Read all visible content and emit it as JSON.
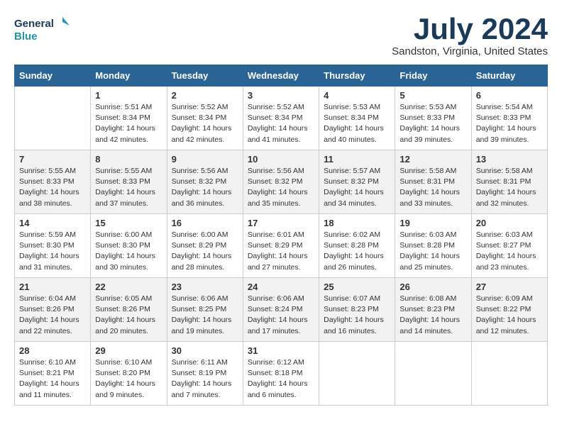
{
  "logo": {
    "line1": "General",
    "line2": "Blue"
  },
  "title": "July 2024",
  "location": "Sandston, Virginia, United States",
  "days_header": [
    "Sunday",
    "Monday",
    "Tuesday",
    "Wednesday",
    "Thursday",
    "Friday",
    "Saturday"
  ],
  "weeks": [
    [
      {
        "day": "",
        "info": ""
      },
      {
        "day": "1",
        "info": "Sunrise: 5:51 AM\nSunset: 8:34 PM\nDaylight: 14 hours\nand 42 minutes."
      },
      {
        "day": "2",
        "info": "Sunrise: 5:52 AM\nSunset: 8:34 PM\nDaylight: 14 hours\nand 42 minutes."
      },
      {
        "day": "3",
        "info": "Sunrise: 5:52 AM\nSunset: 8:34 PM\nDaylight: 14 hours\nand 41 minutes."
      },
      {
        "day": "4",
        "info": "Sunrise: 5:53 AM\nSunset: 8:34 PM\nDaylight: 14 hours\nand 40 minutes."
      },
      {
        "day": "5",
        "info": "Sunrise: 5:53 AM\nSunset: 8:33 PM\nDaylight: 14 hours\nand 39 minutes."
      },
      {
        "day": "6",
        "info": "Sunrise: 5:54 AM\nSunset: 8:33 PM\nDaylight: 14 hours\nand 39 minutes."
      }
    ],
    [
      {
        "day": "7",
        "info": "Sunrise: 5:55 AM\nSunset: 8:33 PM\nDaylight: 14 hours\nand 38 minutes."
      },
      {
        "day": "8",
        "info": "Sunrise: 5:55 AM\nSunset: 8:33 PM\nDaylight: 14 hours\nand 37 minutes."
      },
      {
        "day": "9",
        "info": "Sunrise: 5:56 AM\nSunset: 8:32 PM\nDaylight: 14 hours\nand 36 minutes."
      },
      {
        "day": "10",
        "info": "Sunrise: 5:56 AM\nSunset: 8:32 PM\nDaylight: 14 hours\nand 35 minutes."
      },
      {
        "day": "11",
        "info": "Sunrise: 5:57 AM\nSunset: 8:32 PM\nDaylight: 14 hours\nand 34 minutes."
      },
      {
        "day": "12",
        "info": "Sunrise: 5:58 AM\nSunset: 8:31 PM\nDaylight: 14 hours\nand 33 minutes."
      },
      {
        "day": "13",
        "info": "Sunrise: 5:58 AM\nSunset: 8:31 PM\nDaylight: 14 hours\nand 32 minutes."
      }
    ],
    [
      {
        "day": "14",
        "info": "Sunrise: 5:59 AM\nSunset: 8:30 PM\nDaylight: 14 hours\nand 31 minutes."
      },
      {
        "day": "15",
        "info": "Sunrise: 6:00 AM\nSunset: 8:30 PM\nDaylight: 14 hours\nand 30 minutes."
      },
      {
        "day": "16",
        "info": "Sunrise: 6:00 AM\nSunset: 8:29 PM\nDaylight: 14 hours\nand 28 minutes."
      },
      {
        "day": "17",
        "info": "Sunrise: 6:01 AM\nSunset: 8:29 PM\nDaylight: 14 hours\nand 27 minutes."
      },
      {
        "day": "18",
        "info": "Sunrise: 6:02 AM\nSunset: 8:28 PM\nDaylight: 14 hours\nand 26 minutes."
      },
      {
        "day": "19",
        "info": "Sunrise: 6:03 AM\nSunset: 8:28 PM\nDaylight: 14 hours\nand 25 minutes."
      },
      {
        "day": "20",
        "info": "Sunrise: 6:03 AM\nSunset: 8:27 PM\nDaylight: 14 hours\nand 23 minutes."
      }
    ],
    [
      {
        "day": "21",
        "info": "Sunrise: 6:04 AM\nSunset: 8:26 PM\nDaylight: 14 hours\nand 22 minutes."
      },
      {
        "day": "22",
        "info": "Sunrise: 6:05 AM\nSunset: 8:26 PM\nDaylight: 14 hours\nand 20 minutes."
      },
      {
        "day": "23",
        "info": "Sunrise: 6:06 AM\nSunset: 8:25 PM\nDaylight: 14 hours\nand 19 minutes."
      },
      {
        "day": "24",
        "info": "Sunrise: 6:06 AM\nSunset: 8:24 PM\nDaylight: 14 hours\nand 17 minutes."
      },
      {
        "day": "25",
        "info": "Sunrise: 6:07 AM\nSunset: 8:23 PM\nDaylight: 14 hours\nand 16 minutes."
      },
      {
        "day": "26",
        "info": "Sunrise: 6:08 AM\nSunset: 8:23 PM\nDaylight: 14 hours\nand 14 minutes."
      },
      {
        "day": "27",
        "info": "Sunrise: 6:09 AM\nSunset: 8:22 PM\nDaylight: 14 hours\nand 12 minutes."
      }
    ],
    [
      {
        "day": "28",
        "info": "Sunrise: 6:10 AM\nSunset: 8:21 PM\nDaylight: 14 hours\nand 11 minutes."
      },
      {
        "day": "29",
        "info": "Sunrise: 6:10 AM\nSunset: 8:20 PM\nDaylight: 14 hours\nand 9 minutes."
      },
      {
        "day": "30",
        "info": "Sunrise: 6:11 AM\nSunset: 8:19 PM\nDaylight: 14 hours\nand 7 minutes."
      },
      {
        "day": "31",
        "info": "Sunrise: 6:12 AM\nSunset: 8:18 PM\nDaylight: 14 hours\nand 6 minutes."
      },
      {
        "day": "",
        "info": ""
      },
      {
        "day": "",
        "info": ""
      },
      {
        "day": "",
        "info": ""
      }
    ]
  ]
}
